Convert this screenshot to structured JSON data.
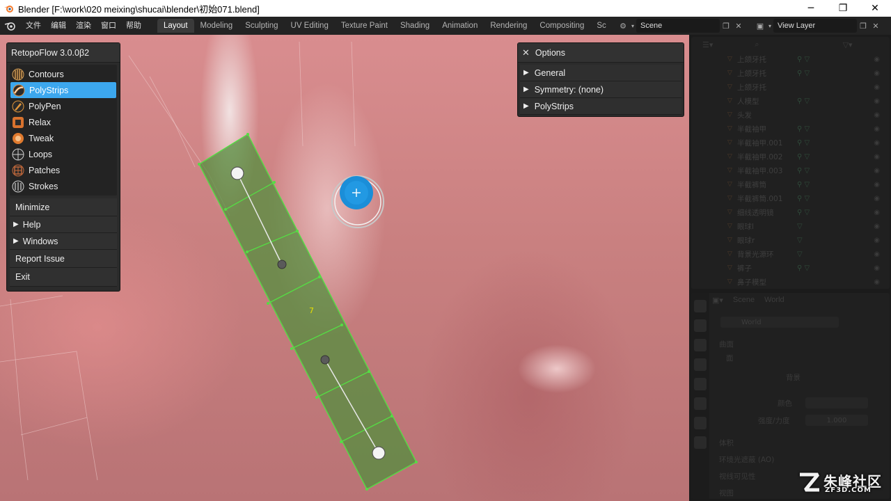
{
  "window": {
    "title": "Blender [F:\\work\\020 meixing\\shucai\\blender\\初始071.blend]",
    "minimize": "─",
    "maximize": "❐",
    "close": "✕"
  },
  "menu": [
    "文件",
    "编辑",
    "渲染",
    "窗口",
    "帮助"
  ],
  "workspaces": [
    {
      "label": "Layout",
      "active": true
    },
    {
      "label": "Modeling"
    },
    {
      "label": "Sculpting"
    },
    {
      "label": "UV Editing"
    },
    {
      "label": "Texture Paint"
    },
    {
      "label": "Shading"
    },
    {
      "label": "Animation"
    },
    {
      "label": "Rendering"
    },
    {
      "label": "Compositing"
    },
    {
      "label": "Sc"
    }
  ],
  "scene_selector": {
    "value": "Scene"
  },
  "view_layer_selector": {
    "value": "View Layer"
  },
  "retopoflow": {
    "title": "RetopoFlow 3.0.0β2",
    "tools": [
      {
        "label": "Contours",
        "icon": "contours-icon",
        "color": "#d9a35a"
      },
      {
        "label": "PolyStrips",
        "icon": "polystrips-icon",
        "color": "#e08a3a",
        "active": true
      },
      {
        "label": "PolyPen",
        "icon": "polypen-icon",
        "color": "#e0953a"
      },
      {
        "label": "Relax",
        "icon": "relax-icon",
        "color": "#d8722e"
      },
      {
        "label": "Tweak",
        "icon": "tweak-icon",
        "color": "#e07a2e"
      },
      {
        "label": "Loops",
        "icon": "loops-icon",
        "color": "#d0d0d0"
      },
      {
        "label": "Patches",
        "icon": "patches-icon",
        "color": "#c86a3a"
      },
      {
        "label": "Strokes",
        "icon": "strokes-icon",
        "color": "#d0d0d0"
      }
    ],
    "minimize": "Minimize",
    "help": "Help",
    "windows": "Windows",
    "report": "Report Issue",
    "exit": "Exit"
  },
  "options": {
    "title": "Options",
    "close": "✕",
    "sections": [
      "General",
      "Symmetry: (none)",
      "PolyStrips"
    ]
  },
  "viewport": {
    "strip_segment_count": "7"
  },
  "outliner": {
    "rows": [
      {
        "name": "上颌牙托",
        "mods": "⚲ ▽"
      },
      {
        "name": "上颌牙托",
        "mods": "⚲ ▽"
      },
      {
        "name": "上颌牙托",
        "mods": ""
      },
      {
        "name": "人模型",
        "mods": "⚲ ▽"
      },
      {
        "name": "头发",
        "mods": ""
      },
      {
        "name": "半截袖甲",
        "mods": "⚲ ▽"
      },
      {
        "name": "半截袖甲.001",
        "mods": "⚲ ▽"
      },
      {
        "name": "半截袖甲.002",
        "mods": "⚲ ▽"
      },
      {
        "name": "半截袖甲.003",
        "mods": "⚲ ▽"
      },
      {
        "name": "半截裤筒",
        "mods": "⚲ ▽"
      },
      {
        "name": "半截裤筒.001",
        "mods": "⚲ ▽"
      },
      {
        "name": "细线透明镜",
        "mods": "⚲ ▽"
      },
      {
        "name": "眼球l",
        "mods": "▽"
      },
      {
        "name": "眼球r",
        "mods": "▽"
      },
      {
        "name": "背景光源环",
        "mods": "▽"
      },
      {
        "name": "裤子",
        "mods": "⚲ ▽"
      },
      {
        "name": "鼻子模型",
        "mods": ""
      }
    ]
  },
  "properties": {
    "tab_scene": "Scene",
    "tab_world": "World",
    "world_field": "World",
    "section1": "曲面",
    "section2": "面",
    "bg_label": "背景",
    "color_label": "颜色",
    "strength_label": "强度/力度",
    "strength_value": "1.000",
    "section3": "体积",
    "ao": "环境光遮蔽 (AO)",
    "section4": "视线可见性",
    "section5": "视图"
  },
  "watermark": {
    "main": "朱峰社区",
    "sub": "ZF3D.COM"
  }
}
